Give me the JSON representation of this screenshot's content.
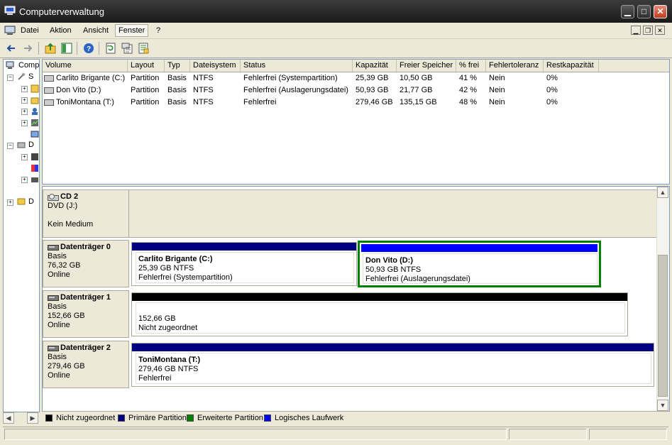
{
  "window": {
    "title": "Computerverwaltung"
  },
  "menu": {
    "items": [
      "Datei",
      "Aktion",
      "Ansicht",
      "Fenster",
      "?"
    ]
  },
  "tree": {
    "items": [
      "Comp",
      "S",
      "D",
      "D"
    ]
  },
  "volumes": {
    "columns": [
      "Volume",
      "Layout",
      "Typ",
      "Dateisystem",
      "Status",
      "Kapazität",
      "Freier Speicher",
      "% frei",
      "Fehlertoleranz",
      "Restkapazität"
    ],
    "rows": [
      [
        "Carlito Brigante (C:)",
        "Partition",
        "Basis",
        "NTFS",
        "Fehlerfrei (Systempartition)",
        "25,39 GB",
        "10,50 GB",
        "41 %",
        "Nein",
        "0%"
      ],
      [
        "Don Vito (D:)",
        "Partition",
        "Basis",
        "NTFS",
        "Fehlerfrei (Auslagerungsdatei)",
        "50,93 GB",
        "21,77 GB",
        "42 %",
        "Nein",
        "0%"
      ],
      [
        "ToniMontana (T:)",
        "Partition",
        "Basis",
        "NTFS",
        "Fehlerfrei",
        "279,46 GB",
        "135,15 GB",
        "48 %",
        "Nein",
        "0%"
      ]
    ]
  },
  "disks": [
    {
      "name": "CD 2",
      "lines": [
        "DVD (J:)",
        "",
        "Kein Medium"
      ]
    },
    {
      "name": "Datenträger 0",
      "lines": [
        "Basis",
        "76,32 GB",
        "Online"
      ]
    },
    {
      "name": "Datenträger 1",
      "lines": [
        "Basis",
        "152,66 GB",
        "Online"
      ]
    },
    {
      "name": "Datenträger 2",
      "lines": [
        "Basis",
        "279,46 GB",
        "Online"
      ]
    }
  ],
  "partitions": {
    "c": {
      "name": "Carlito Brigante  (C:)",
      "size": "25,39 GB NTFS",
      "status": "Fehlerfrei (Systempartition)"
    },
    "d": {
      "name": "Don Vito  (D:)",
      "size": "50,93 GB NTFS",
      "status": "Fehlerfrei (Auslagerungsdatei)"
    },
    "u": {
      "size": "152,66 GB",
      "status": "Nicht zugeordnet"
    },
    "t": {
      "name": "ToniMontana  (T:)",
      "size": "279,46 GB NTFS",
      "status": "Fehlerfrei"
    }
  },
  "legend": [
    {
      "label": "Nicht zugeordnet",
      "color": "#000000"
    },
    {
      "label": "Primäre Partition",
      "color": "#000080"
    },
    {
      "label": "Erweiterte Partition",
      "color": "#008000"
    },
    {
      "label": "Logisches Laufwerk",
      "color": "#0000ff"
    }
  ],
  "colors": {
    "primary": "#000080",
    "logical": "#0000ff",
    "extended": "#008000",
    "unallocated": "#000000"
  },
  "icons": {
    "toolbar": [
      "back-arrow-icon",
      "forward-arrow-icon",
      "up-folder-icon",
      "show-hide-tree-icon",
      "help-icon",
      "refresh-icon",
      "properties-icon",
      "export-list-icon"
    ]
  }
}
